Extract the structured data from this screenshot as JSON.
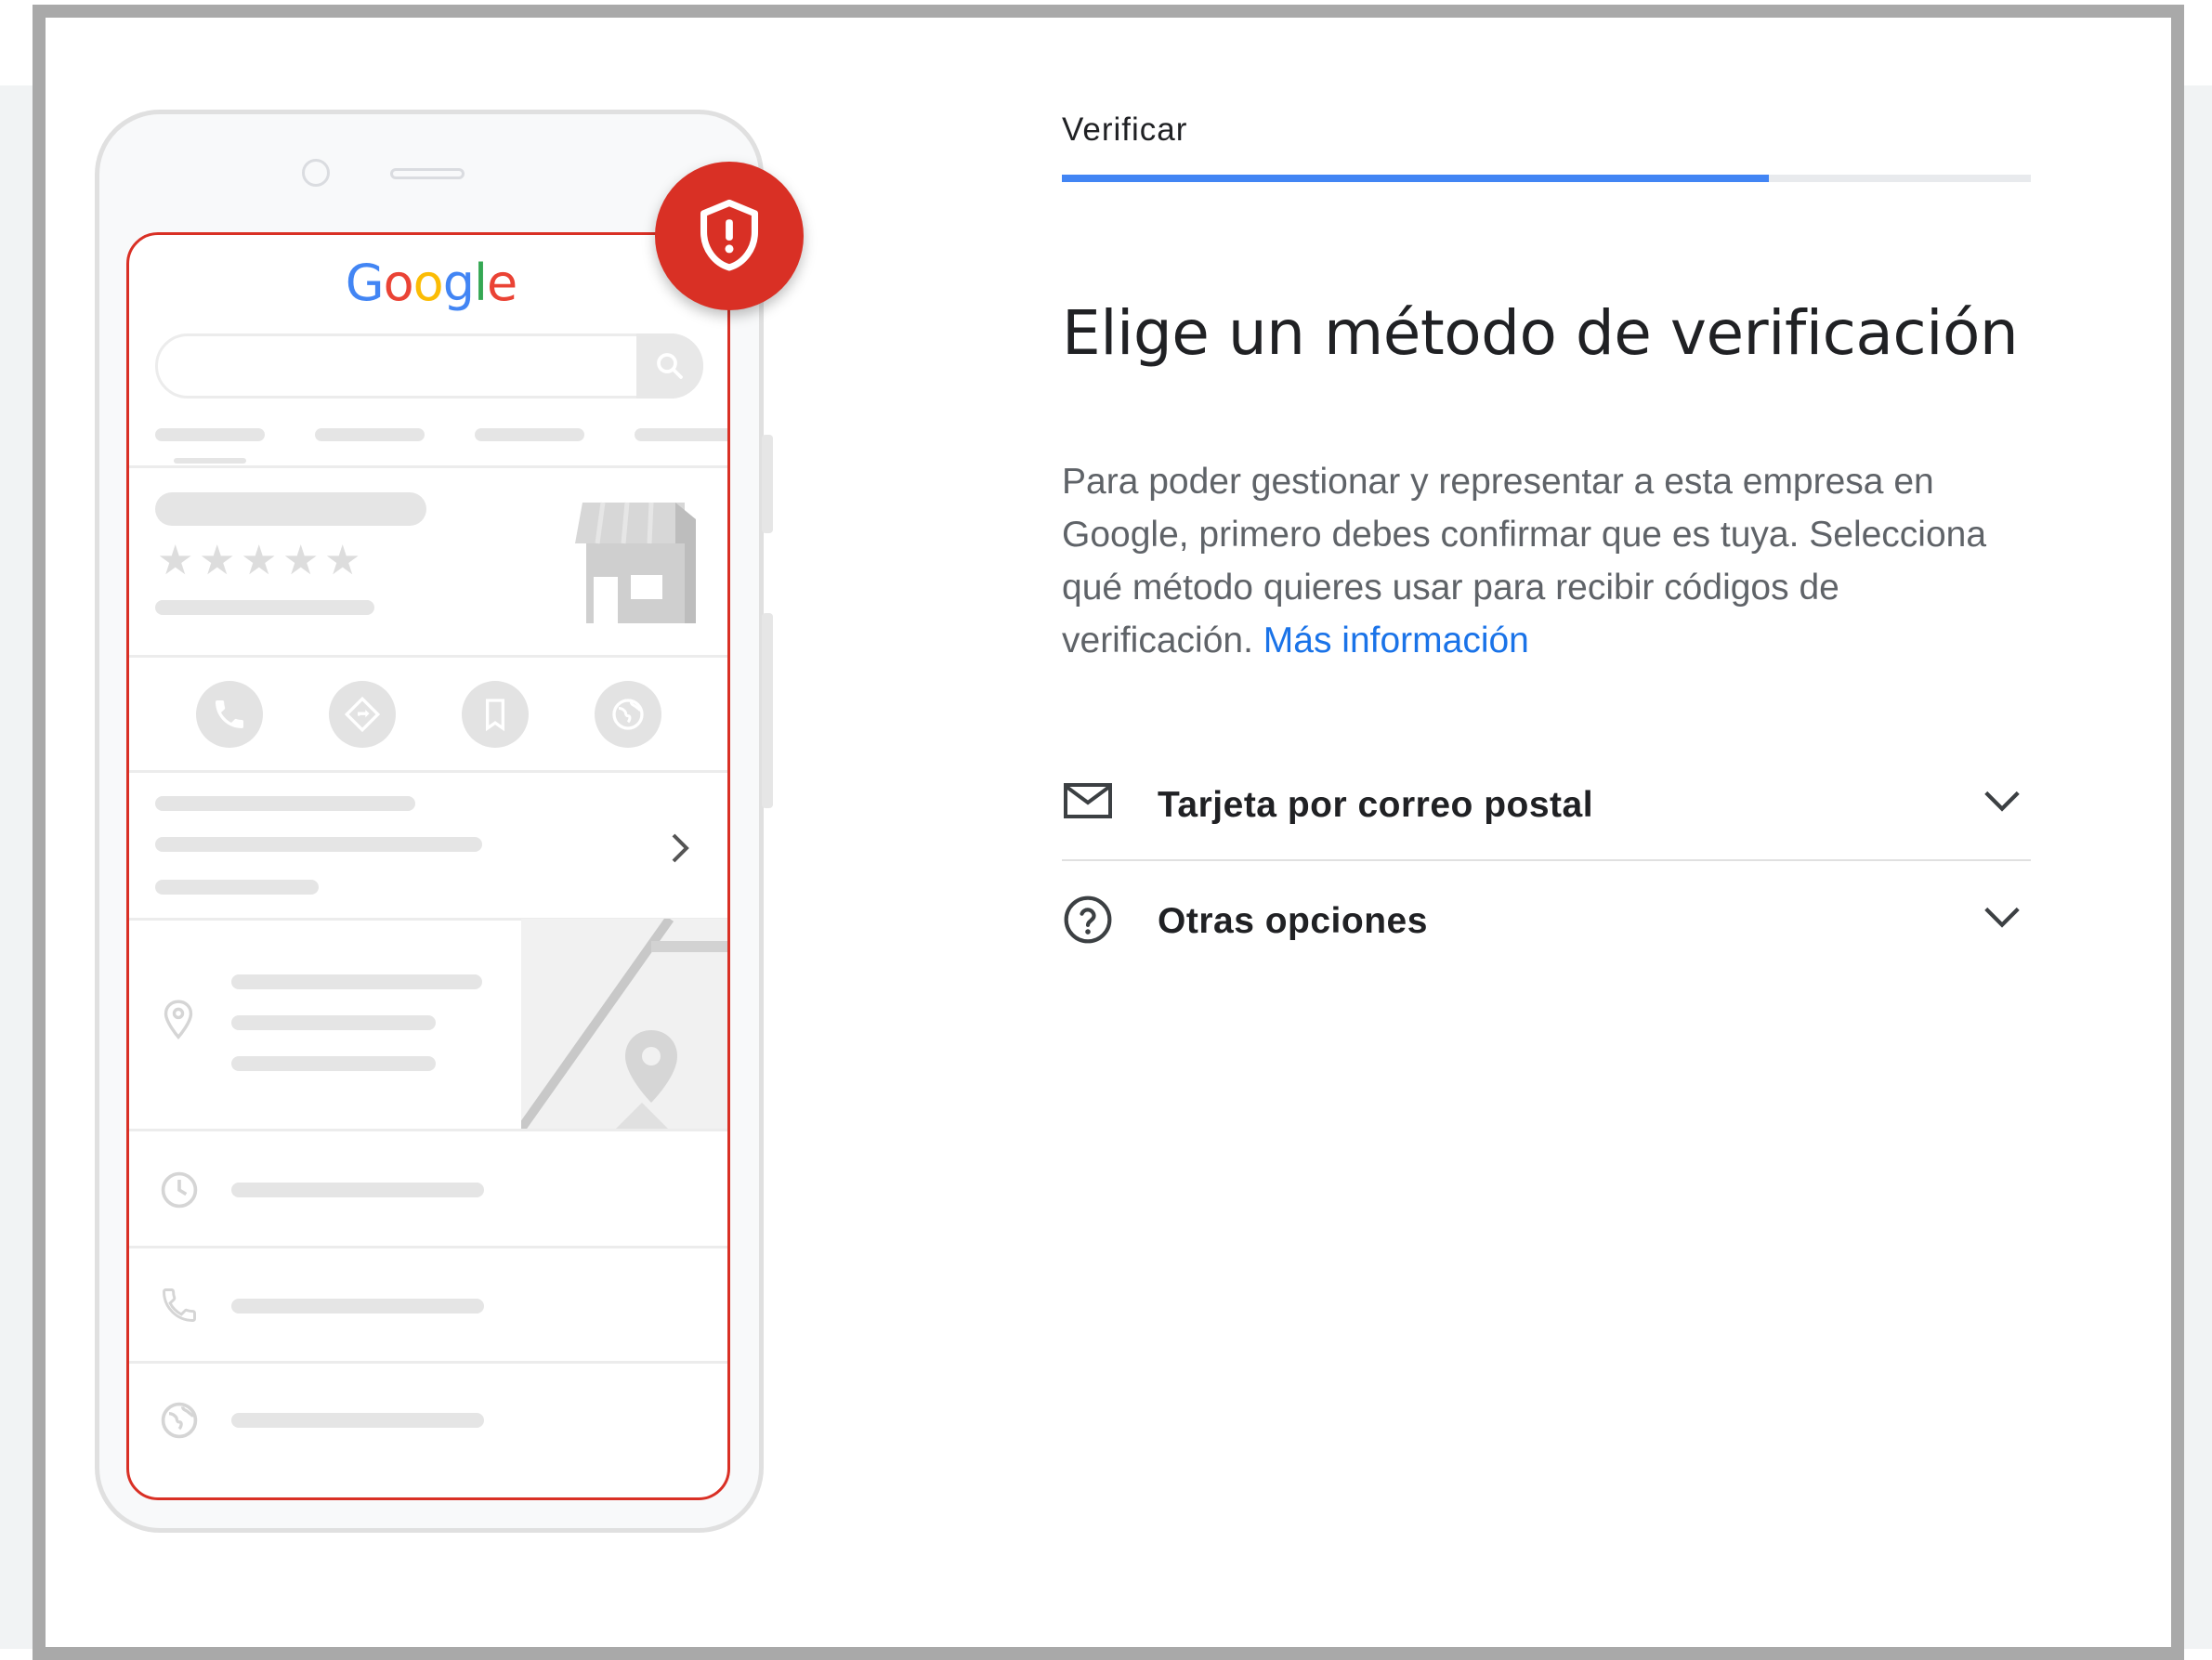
{
  "illustration": {
    "google_logo": [
      "G",
      "o",
      "o",
      "g",
      "l",
      "e"
    ],
    "rating_stars": [
      "★",
      "★",
      "★",
      "★",
      "★"
    ],
    "icons": [
      "shield-alert-icon",
      "search-icon",
      "store-icon",
      "phone-icon",
      "directions-icon",
      "bookmark-icon",
      "globe-icon",
      "chevron-right-icon",
      "location-pin-icon",
      "clock-icon",
      "map-icon"
    ],
    "colors": {
      "badge": "#d93025",
      "screen_border": "#d93025"
    }
  },
  "stepper": {
    "label": "Verificar",
    "progress": 0.73,
    "color": "#4285f4"
  },
  "main": {
    "title": "Elige un método de verificación",
    "description": "Para poder gestionar y representar a esta empresa en Google, primero debes confirmar que es tuya. Selecciona qué método quieres usar para recibir códigos de verificación.",
    "learn_more": "Más información",
    "link_color": "#1a73e8"
  },
  "options": [
    {
      "label": "Tarjeta por correo postal",
      "icon": "mail-icon",
      "expand_icon": "chevron-down-icon"
    },
    {
      "label": "Otras opciones",
      "icon": "help-circle-icon",
      "expand_icon": "chevron-down-icon"
    }
  ]
}
